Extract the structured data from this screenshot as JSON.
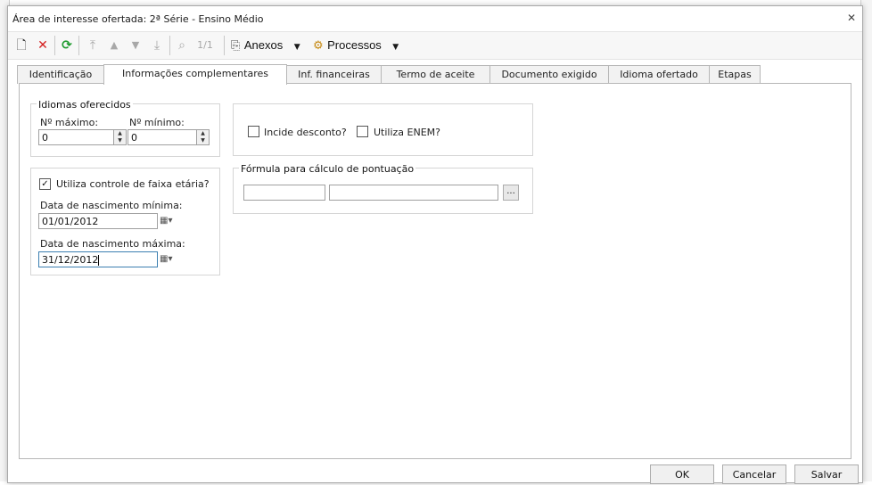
{
  "window": {
    "title": "Área de interesse ofertada: 2ª Série - Ensino Médio"
  },
  "toolbar": {
    "record_counter": "1/1",
    "attachments_label": "Anexos",
    "processes_label": "Processos"
  },
  "tabs": [
    {
      "label": "Identificação"
    },
    {
      "label": "Informações complementares"
    },
    {
      "label": "Inf. financeiras"
    },
    {
      "label": "Termo de aceite"
    },
    {
      "label": "Documento exigido"
    },
    {
      "label": "Idioma ofertado"
    },
    {
      "label": "Etapas"
    }
  ],
  "languages": {
    "title": "Idiomas oferecidos",
    "max_label": "Nº máximo:",
    "max_value": "0",
    "min_label": "Nº mínimo:",
    "min_value": "0"
  },
  "age": {
    "check_label": "Utiliza controle de faixa etária?",
    "checked": true,
    "min_label": "Data de nascimento mínima:",
    "min_value": "01/01/2012",
    "max_label": "Data de nascimento máxima:",
    "max_value": "31/12/2012"
  },
  "options": {
    "discount_label": "Incide desconto?",
    "enem_label": "Utiliza ENEM?"
  },
  "formula": {
    "title": "Fórmula para cálculo de pontuação",
    "code_value": "",
    "description_value": "",
    "browse_label": "..."
  },
  "buttons": {
    "ok": "OK",
    "cancel": "Cancelar",
    "save": "Salvar"
  }
}
